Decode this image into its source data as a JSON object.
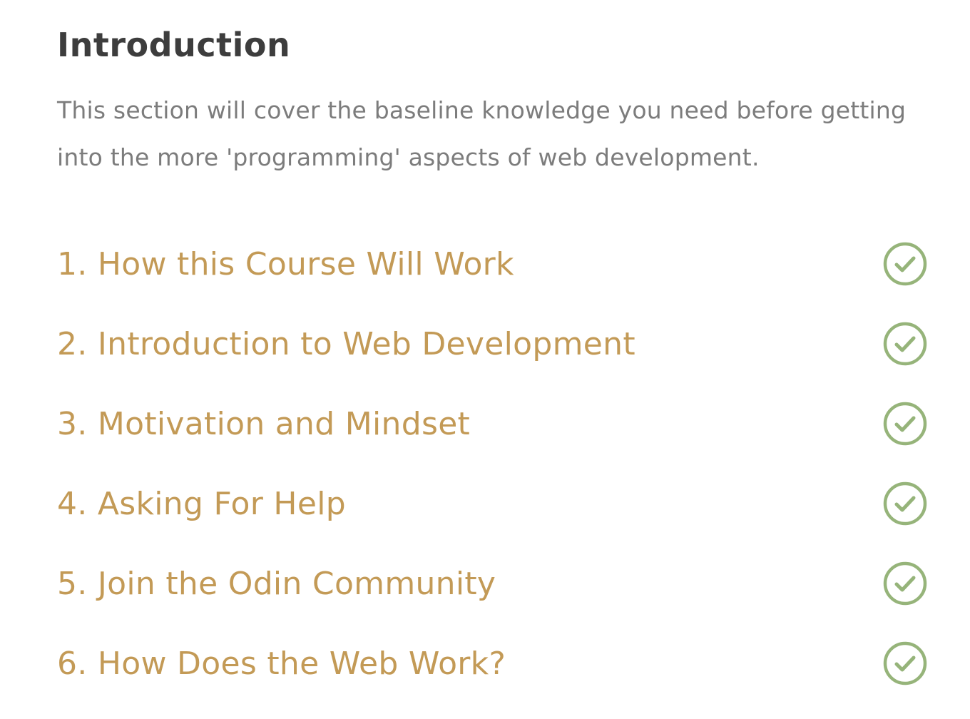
{
  "section": {
    "title": "Introduction",
    "description": "This section will cover the baseline knowledge you need before getting into the more 'programming' aspects of web development."
  },
  "lessons": [
    {
      "label": "1. How this Course Will Work",
      "completed": true,
      "icon": "check-circle-icon"
    },
    {
      "label": "2. Introduction to Web Development",
      "completed": true,
      "icon": "check-circle-icon"
    },
    {
      "label": "3. Motivation and Mindset",
      "completed": true,
      "icon": "check-circle-icon"
    },
    {
      "label": "4. Asking For Help",
      "completed": true,
      "icon": "check-circle-icon"
    },
    {
      "label": "5. Join the Odin Community",
      "completed": true,
      "icon": "check-circle-icon"
    },
    {
      "label": "6. How Does the Web Work?",
      "completed": true,
      "icon": "check-circle-icon"
    }
  ],
  "colors": {
    "title": "#3d3d3d",
    "description": "#7c7c7c",
    "lesson_link": "#c39a56",
    "check": "#96b47a"
  }
}
